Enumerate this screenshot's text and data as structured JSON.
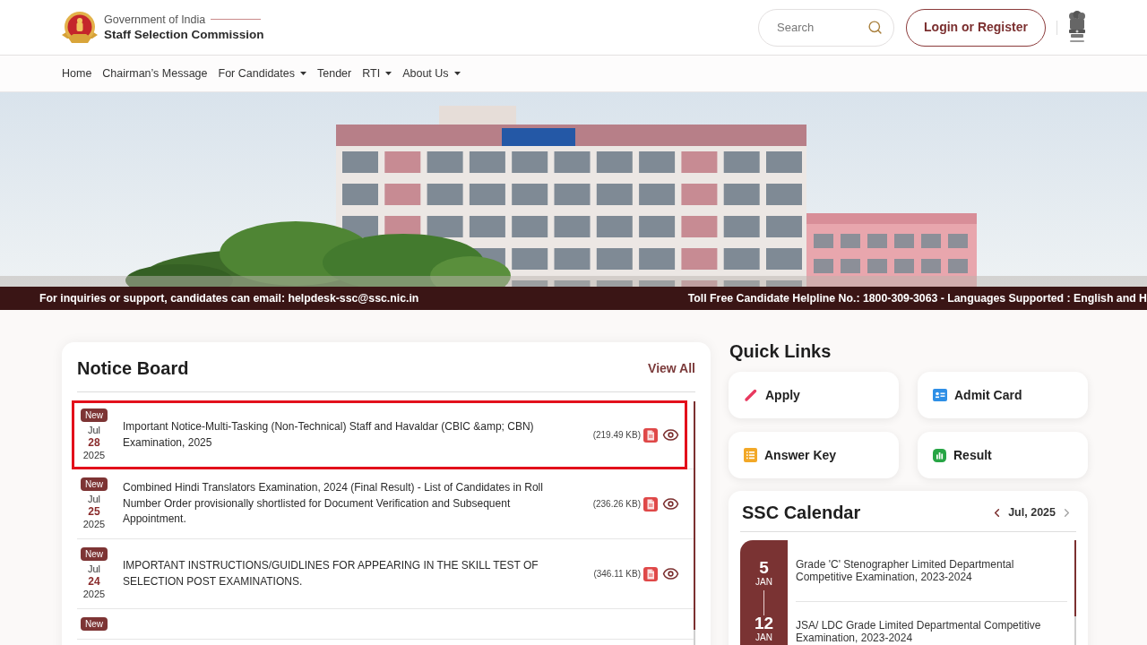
{
  "header": {
    "logo": {
      "line1": "Government of India",
      "line2": "Staff Selection Commission"
    },
    "search": {
      "placeholder": "Search"
    },
    "login_button": "Login or Register"
  },
  "nav": [
    {
      "label": "Home",
      "dropdown": false
    },
    {
      "label": "Chairman’s Message",
      "dropdown": false
    },
    {
      "label": "For Candidates",
      "dropdown": true
    },
    {
      "label": "Tender",
      "dropdown": false
    },
    {
      "label": "RTI",
      "dropdown": true
    },
    {
      "label": "About Us",
      "dropdown": true
    }
  ],
  "ticker": [
    "For inquiries or support, candidates can email: helpdesk-ssc@ssc.nic.in",
    "Toll Free Candidate Helpline No.: 1800-309-3063 - Languages Supported : English and H"
  ],
  "notice_board": {
    "title": "Notice Board",
    "view_all": "View All",
    "notices": [
      {
        "badge": "New",
        "month": "Jul",
        "day": "28",
        "year": "2025",
        "title": "Important Notice-Multi-Tasking (Non-Technical) Staff and Havaldar (CBIC &amp; CBN) Examination, 2025",
        "size": "(219.49 KB)",
        "highlighted": true
      },
      {
        "badge": "New",
        "month": "Jul",
        "day": "25",
        "year": "2025",
        "title": "Combined Hindi Translators Examination, 2024 (Final Result) - List of Candidates in Roll Number Order provisionally shortlisted for Document Verification and Subsequent Appointment.",
        "size": "(236.26 KB)",
        "highlighted": false
      },
      {
        "badge": "New",
        "month": "Jul",
        "day": "24",
        "year": "2025",
        "title": "IMPORTANT INSTRUCTIONS/GUIDLINES FOR APPEARING IN THE SKILL TEST OF SELECTION POST EXAMINATIONS.",
        "size": "(346.11 KB)",
        "highlighted": false
      },
      {
        "badge": "New",
        "highlighted": false
      }
    ]
  },
  "quick_links": {
    "title": "Quick Links",
    "links": [
      {
        "label": "Apply",
        "kind": "apply"
      },
      {
        "label": "Admit Card",
        "kind": "admit"
      },
      {
        "label": "Answer Key",
        "kind": "answer"
      },
      {
        "label": "Result",
        "kind": "result"
      }
    ]
  },
  "calendar": {
    "title": "SSC Calendar",
    "month": "Jul, 2025",
    "events": [
      {
        "day": "5",
        "month": "JAN",
        "title": "Grade 'C' Stenographer Limited Departmental Competitive Examination, 2023-2024"
      },
      {
        "day": "12",
        "month": "JAN",
        "title": "JSA/ LDC Grade Limited Departmental Competitive Examination, 2023-2024"
      }
    ]
  }
}
